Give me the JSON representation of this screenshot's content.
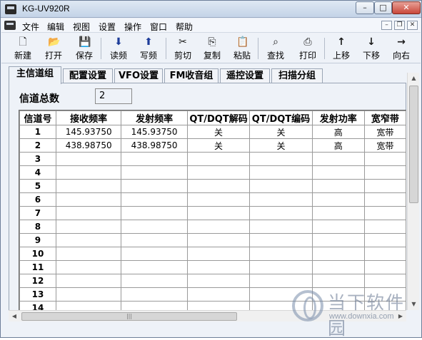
{
  "window": {
    "title": "KG-UV920R",
    "min": "–",
    "max": "□",
    "close": "✕"
  },
  "menubar": {
    "items": [
      "文件",
      "编辑",
      "视图",
      "设置",
      "操作",
      "窗口",
      "帮助"
    ],
    "mdi_min": "–",
    "mdi_restore": "❐",
    "mdi_close": "✕"
  },
  "toolbar": {
    "buttons": [
      {
        "label": "新建",
        "icon": "new-file-icon",
        "glyph": "🗋"
      },
      {
        "label": "打开",
        "icon": "open-folder-icon",
        "glyph": "📂"
      },
      {
        "label": "保存",
        "icon": "save-disk-icon",
        "glyph": "💾"
      },
      {
        "label": "读频",
        "icon": "arrow-down-icon",
        "glyph": "⬇"
      },
      {
        "label": "写频",
        "icon": "arrow-up-icon",
        "glyph": "⬆"
      },
      {
        "label": "剪切",
        "icon": "scissors-icon",
        "glyph": "✂"
      },
      {
        "label": "复制",
        "icon": "copy-icon",
        "glyph": "⎘"
      },
      {
        "label": "粘贴",
        "icon": "paste-icon",
        "glyph": "📋"
      },
      {
        "label": "查找",
        "icon": "binoculars-icon",
        "glyph": "⌕"
      },
      {
        "label": "打印",
        "icon": "printer-icon",
        "glyph": "⎙"
      },
      {
        "label": "上移",
        "icon": "move-up-icon",
        "glyph": "↑"
      },
      {
        "label": "下移",
        "icon": "move-down-icon",
        "glyph": "↓"
      },
      {
        "label": "向右",
        "icon": "move-right-icon",
        "glyph": "→"
      }
    ]
  },
  "tabs": [
    "主信道组",
    "配置设置",
    "VFO设置",
    "FM收音组",
    "遥控设置",
    "扫描分组"
  ],
  "channel_count": {
    "label": "信道总数",
    "value": "2"
  },
  "grid": {
    "headers": [
      "信道号",
      "接收频率",
      "发射频率",
      "QT/DQT解码",
      "QT/DQT编码",
      "发射功率",
      "宽窄带"
    ],
    "rows": [
      [
        "1",
        "145.93750",
        "145.93750",
        "关",
        "关",
        "高",
        "宽带"
      ],
      [
        "2",
        "438.98750",
        "438.98750",
        "关",
        "关",
        "高",
        "宽带"
      ],
      [
        "3",
        "",
        "",
        "",
        "",
        "",
        ""
      ],
      [
        "4",
        "",
        "",
        "",
        "",
        "",
        ""
      ],
      [
        "5",
        "",
        "",
        "",
        "",
        "",
        ""
      ],
      [
        "6",
        "",
        "",
        "",
        "",
        "",
        ""
      ],
      [
        "7",
        "",
        "",
        "",
        "",
        "",
        ""
      ],
      [
        "8",
        "",
        "",
        "",
        "",
        "",
        ""
      ],
      [
        "9",
        "",
        "",
        "",
        "",
        "",
        ""
      ],
      [
        "10",
        "",
        "",
        "",
        "",
        "",
        ""
      ],
      [
        "11",
        "",
        "",
        "",
        "",
        "",
        ""
      ],
      [
        "12",
        "",
        "",
        "",
        "",
        "",
        ""
      ],
      [
        "13",
        "",
        "",
        "",
        "",
        "",
        ""
      ],
      [
        "14",
        "",
        "",
        "",
        "",
        "",
        ""
      ]
    ]
  },
  "scrollbars": {
    "up": "▲",
    "down": "▼",
    "left": "◀",
    "right": "▶",
    "grip": "|||"
  },
  "watermark": {
    "name": "当下软件园",
    "url": "www.downxia.com"
  }
}
